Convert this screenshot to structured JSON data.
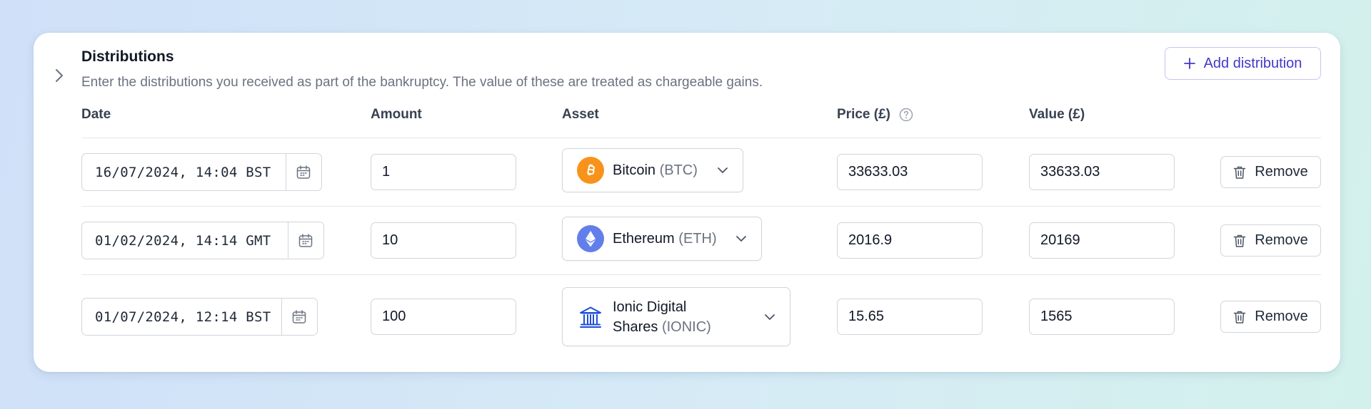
{
  "section": {
    "title": "Distributions",
    "description": "Enter the distributions you received as part of the bankruptcy. The value of these are treated as chargeable gains.",
    "add_button": "Add distribution"
  },
  "columns": {
    "date": "Date",
    "amount": "Amount",
    "asset": "Asset",
    "price": "Price (£)",
    "value": "Value (£)"
  },
  "rows": [
    {
      "date": "16/07/2024, 14:04 BST",
      "amount": "1",
      "asset_name": "Bitcoin",
      "asset_symbol": "(BTC)",
      "asset_icon": "bitcoin-icon",
      "price": "33633.03",
      "value": "33633.03",
      "remove": "Remove"
    },
    {
      "date": "01/02/2024, 14:14 GMT",
      "amount": "10",
      "asset_name": "Ethereum",
      "asset_symbol": "(ETH)",
      "asset_icon": "ethereum-icon",
      "price": "2016.9",
      "value": "20169",
      "remove": "Remove"
    },
    {
      "date": "01/07/2024, 12:14 BST",
      "amount": "100",
      "asset_name_line1": "Ionic Digital",
      "asset_name_line2": "Shares",
      "asset_symbol": "(IONIC)",
      "asset_icon": "bank-icon",
      "price": "15.65",
      "value": "1565",
      "remove": "Remove"
    }
  ],
  "colors": {
    "accent": "#4338ca",
    "bitcoin": "#f7931a",
    "ethereum": "#627eea",
    "bank": "#1d4ed8"
  }
}
